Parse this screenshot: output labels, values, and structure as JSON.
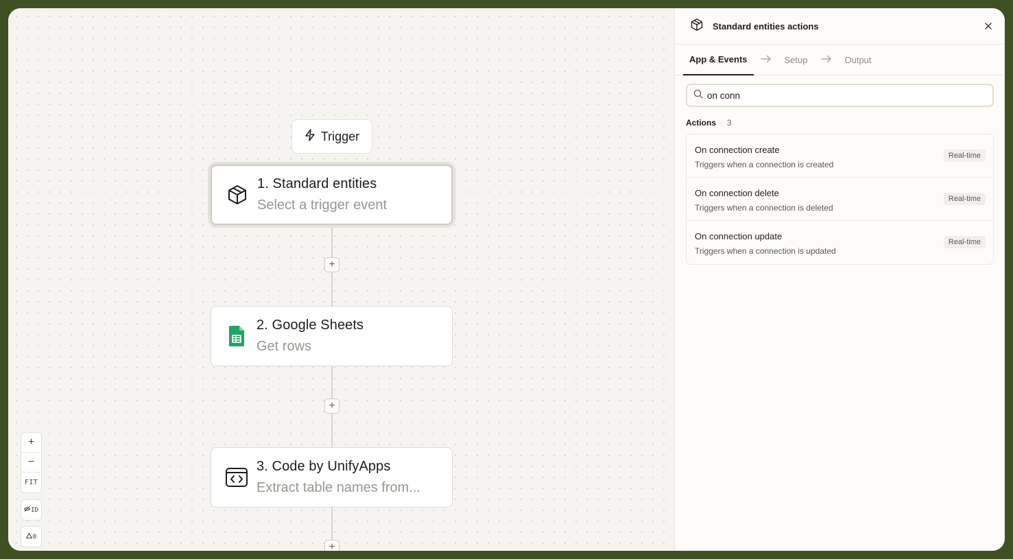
{
  "canvas": {
    "trigger_label": "Trigger",
    "nodes": [
      {
        "title": "1. Standard entities",
        "subtitle": "Select a trigger event"
      },
      {
        "title": "2. Google Sheets",
        "subtitle": "Get rows"
      },
      {
        "title": "3. Code by UnifyApps",
        "subtitle": "Extract table names from..."
      }
    ],
    "zoom_controls": {
      "zoom_in": "+",
      "zoom_out": "−",
      "fit": "FIT"
    },
    "id_toggle": "ID",
    "warnings_count": "0"
  },
  "panel": {
    "title": "Standard entities actions",
    "tabs": [
      {
        "label": "App & Events"
      },
      {
        "label": "Setup"
      },
      {
        "label": "Output"
      }
    ],
    "search": {
      "value": "on conn"
    },
    "section": {
      "label": "Actions",
      "count": "3"
    },
    "actions": [
      {
        "title": "On connection create",
        "description": "Triggers when a connection is created",
        "badge": "Real-time"
      },
      {
        "title": "On connection delete",
        "description": "Triggers when a connection is deleted",
        "badge": "Real-time"
      },
      {
        "title": "On connection update",
        "description": "Triggers when a connection is updated",
        "badge": "Real-time"
      }
    ]
  },
  "colors": {
    "frame": "#3f5124",
    "canvas_bg": "#f6f4f1",
    "sheets_green": "#1fa463",
    "selected_ring": "#e5e1db"
  }
}
